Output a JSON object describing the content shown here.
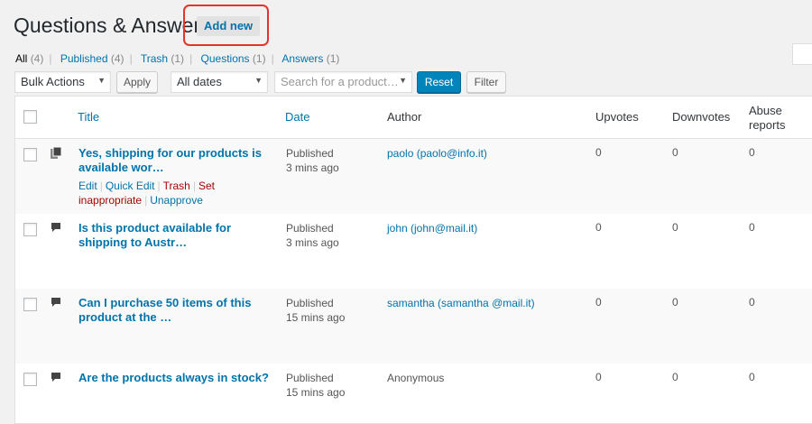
{
  "header": {
    "title": "Questions & Answers",
    "add_new_label": "Add new"
  },
  "views": [
    {
      "label": "All",
      "count": "(4)"
    },
    {
      "label": "Published",
      "count": "(4)"
    },
    {
      "label": "Trash",
      "count": "(1)"
    },
    {
      "label": "Questions",
      "count": "(1)"
    },
    {
      "label": "Answers",
      "count": "(1)"
    }
  ],
  "toolbar": {
    "bulk_actions": "Bulk Actions",
    "apply_label": "Apply",
    "dates": "All dates",
    "product_placeholder": "Search for a product…",
    "reset_label": "Reset",
    "filter_label": "Filter"
  },
  "columns": {
    "title": "Title",
    "date": "Date",
    "author": "Author",
    "upvotes": "Upvotes",
    "downvotes": "Downvotes",
    "abuse_line1": "Abuse",
    "abuse_line2": "reports"
  },
  "rows": [
    {
      "icon": "answers-stack-icon",
      "title": "Yes, shipping for our products is available wor…",
      "status": "Published",
      "age": "3 mins ago",
      "author": "paolo (paolo@info.it)",
      "upvotes": "0",
      "downvotes": "0",
      "abuse": "0",
      "actions": {
        "edit": "Edit",
        "quick_edit": "Quick Edit",
        "trash": "Trash",
        "set_inappropriate": "Set inappropriate",
        "unapprove": "Unapprove"
      }
    },
    {
      "icon": "speech-bubble-icon",
      "title": "Is this product available for shipping to Austr…",
      "status": "Published",
      "age": "3 mins ago",
      "author": "john (john@mail.it)",
      "upvotes": "0",
      "downvotes": "0",
      "abuse": "0"
    },
    {
      "icon": "speech-bubble-icon",
      "title": "Can I purchase 50 items of this product at the …",
      "status": "Published",
      "age": "15 mins ago",
      "author": "samantha (samantha @mail.it)",
      "upvotes": "0",
      "downvotes": "0",
      "abuse": "0"
    },
    {
      "icon": "speech-bubble-icon",
      "title": "Are the products always in stock?",
      "status": "Published",
      "age": "15 mins ago",
      "author": "Anonymous",
      "upvotes": "0",
      "downvotes": "0",
      "abuse": "0"
    }
  ],
  "colors": {
    "link": "#0073aa",
    "primary_button": "#0085ba",
    "danger": "#aa0000",
    "highlight": "#e2342b"
  }
}
